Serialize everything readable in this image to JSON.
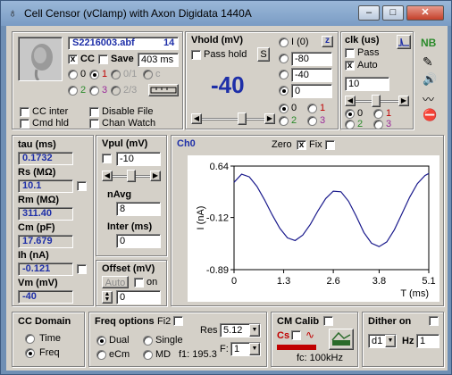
{
  "window": {
    "title": "Cell Censor (vClamp) with Axon Digidata 1440A"
  },
  "file": {
    "name": "S2216003.abf",
    "index": "14",
    "cc_checked": "x",
    "cc_label": "CC",
    "save_label": "Save",
    "save_duration": "403 ms"
  },
  "channels_top": [
    "0",
    "1",
    "0/1",
    "c",
    "2",
    "3",
    "2/3"
  ],
  "options": {
    "cc_inter": "CC inter",
    "cmd_hld": "Cmd hld",
    "disable_file": "Disable File",
    "chan_watch": "Chan Watch"
  },
  "vhold": {
    "title": "Vhold (mV)",
    "pass_hold": "Pass hold",
    "s_button": "S",
    "value": "-40",
    "i_label": "I (0)",
    "z_button": "z",
    "presets": [
      "-80",
      "-40",
      "0"
    ],
    "channels": [
      "0",
      "1",
      "2",
      "3"
    ]
  },
  "clk": {
    "title": "clk (us)",
    "pass": "Pass",
    "auto": "Auto",
    "auto_checked": "x",
    "value": "10",
    "channels": [
      "0",
      "1",
      "2",
      "3"
    ]
  },
  "right_tools": {
    "nb": "NB"
  },
  "measures": [
    {
      "label": "tau (ms)",
      "value": "0.1732"
    },
    {
      "label": "Rs (MΩ)",
      "value": "10.1"
    },
    {
      "label": "Rm (MΩ)",
      "value": "311.40"
    },
    {
      "label": "Cm (pF)",
      "value": "17.679"
    },
    {
      "label": "Ih (nA)",
      "value": "-0.121"
    },
    {
      "label": "Vm (mV)",
      "value": "-40"
    }
  ],
  "vpul": {
    "title": "Vpul (mV)",
    "value": "-10",
    "navg_label": "nAvg",
    "navg": "8",
    "inter_label": "Inter (ms)",
    "inter": "0"
  },
  "offset": {
    "title": "Offset (mV)",
    "auto": "Auto",
    "on": "on",
    "value": "0"
  },
  "chart": {
    "channel": "Ch0",
    "zero_label": "Zero",
    "zero_checked": "x",
    "fix_label": "Fix"
  },
  "chart_data": {
    "type": "line",
    "title": "",
    "xlabel": "T (ms)",
    "ylabel": "I (nA)",
    "xlim": [
      0,
      5.1
    ],
    "ylim": [
      -0.89,
      0.64
    ],
    "xticks": [
      "0",
      "1.3",
      "2.6",
      "3.8",
      "5.1"
    ],
    "yticks": [
      "0.64",
      "-0.12",
      "-0.89"
    ],
    "series": [
      {
        "color": "#1a1a8c",
        "x": [
          0,
          0.2,
          0.4,
          0.6,
          0.8,
          1.0,
          1.2,
          1.4,
          1.6,
          1.8,
          2.0,
          2.2,
          2.4,
          2.6,
          2.8,
          3.0,
          3.2,
          3.4,
          3.6,
          3.8,
          4.0,
          4.2,
          4.4,
          4.6,
          4.8,
          5.0,
          5.1
        ],
        "values": [
          0.4,
          0.52,
          0.48,
          0.34,
          0.14,
          -0.08,
          -0.28,
          -0.42,
          -0.46,
          -0.38,
          -0.22,
          -0.02,
          0.16,
          0.27,
          0.26,
          0.12,
          -0.1,
          -0.34,
          -0.5,
          -0.55,
          -0.48,
          -0.3,
          -0.06,
          0.18,
          0.38,
          0.5,
          0.53
        ]
      }
    ]
  },
  "cc_domain": {
    "title": "CC Domain",
    "time": "Time",
    "freq": "Freq"
  },
  "freq_options": {
    "title": "Freq options",
    "fi2": "Fi2",
    "res_label": "Res",
    "res_value": "5.12",
    "dual": "Dual",
    "single": "Single",
    "ecm": "eCm",
    "md": "MD",
    "f1": "f1: 195.3",
    "f_label": "F:",
    "f_value": "1"
  },
  "cm_calib": {
    "title": "CM Calib",
    "cs": "Cs",
    "fc": "fc: 100kHz"
  },
  "dither": {
    "title": "Dither on",
    "select": "d1",
    "hz_label": "Hz",
    "hz_value": "1"
  }
}
